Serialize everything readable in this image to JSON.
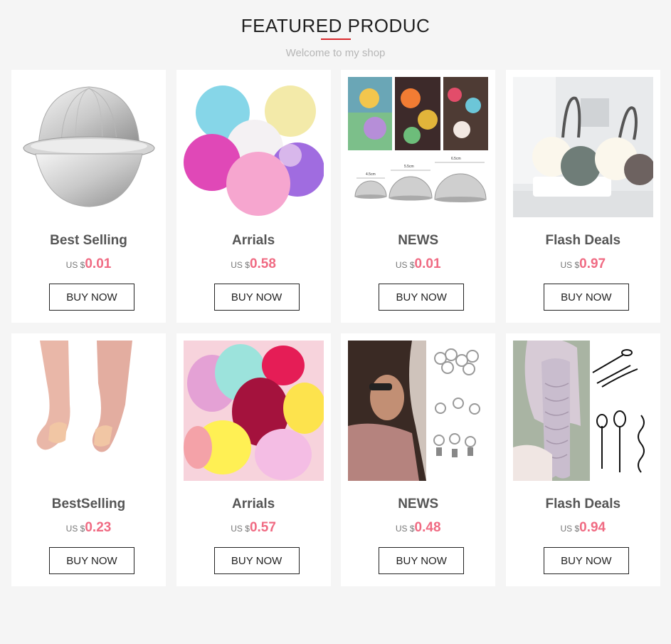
{
  "header": {
    "title": "FEATURED PRODUC",
    "subtitle": "Welcome to my shop",
    "accent_color": "#d9282c"
  },
  "products": [
    {
      "name": "Best Selling",
      "currency": "US $",
      "price": "0.01",
      "button": "BUY NOW",
      "image": "bath-bomb-mold-image"
    },
    {
      "name": "Arrials",
      "currency": "US $",
      "price": "0.58",
      "button": "BUY NOW",
      "image": "bath-sponge-image"
    },
    {
      "name": "NEWS",
      "currency": "US $",
      "price": "0.01",
      "button": "BUY NOW",
      "image": "bath-bomb-collage-image",
      "image_labels": [
        "4.5cm",
        "5.5cm",
        "6.5cm"
      ]
    },
    {
      "name": "Flash Deals",
      "currency": "US $",
      "price": "0.97",
      "button": "BUY NOW",
      "image": "bath-pouf-image"
    },
    {
      "name": "BestSelling",
      "currency": "US $",
      "price": "0.23",
      "button": "BUY NOW",
      "image": "heel-protector-image"
    },
    {
      "name": "Arrials",
      "currency": "US $",
      "price": "0.57",
      "button": "BUY NOW",
      "image": "makeup-sponge-image"
    },
    {
      "name": "NEWS",
      "currency": "US $",
      "price": "0.48",
      "button": "BUY NOW",
      "image": "hair-rings-image"
    },
    {
      "name": "Flash Deals",
      "currency": "US $",
      "price": "0.94",
      "button": "BUY NOW",
      "image": "hair-braid-tools-image"
    }
  ],
  "colors": {
    "price": "#f06b83",
    "name": "#555555",
    "background": "#f5f5f5"
  }
}
